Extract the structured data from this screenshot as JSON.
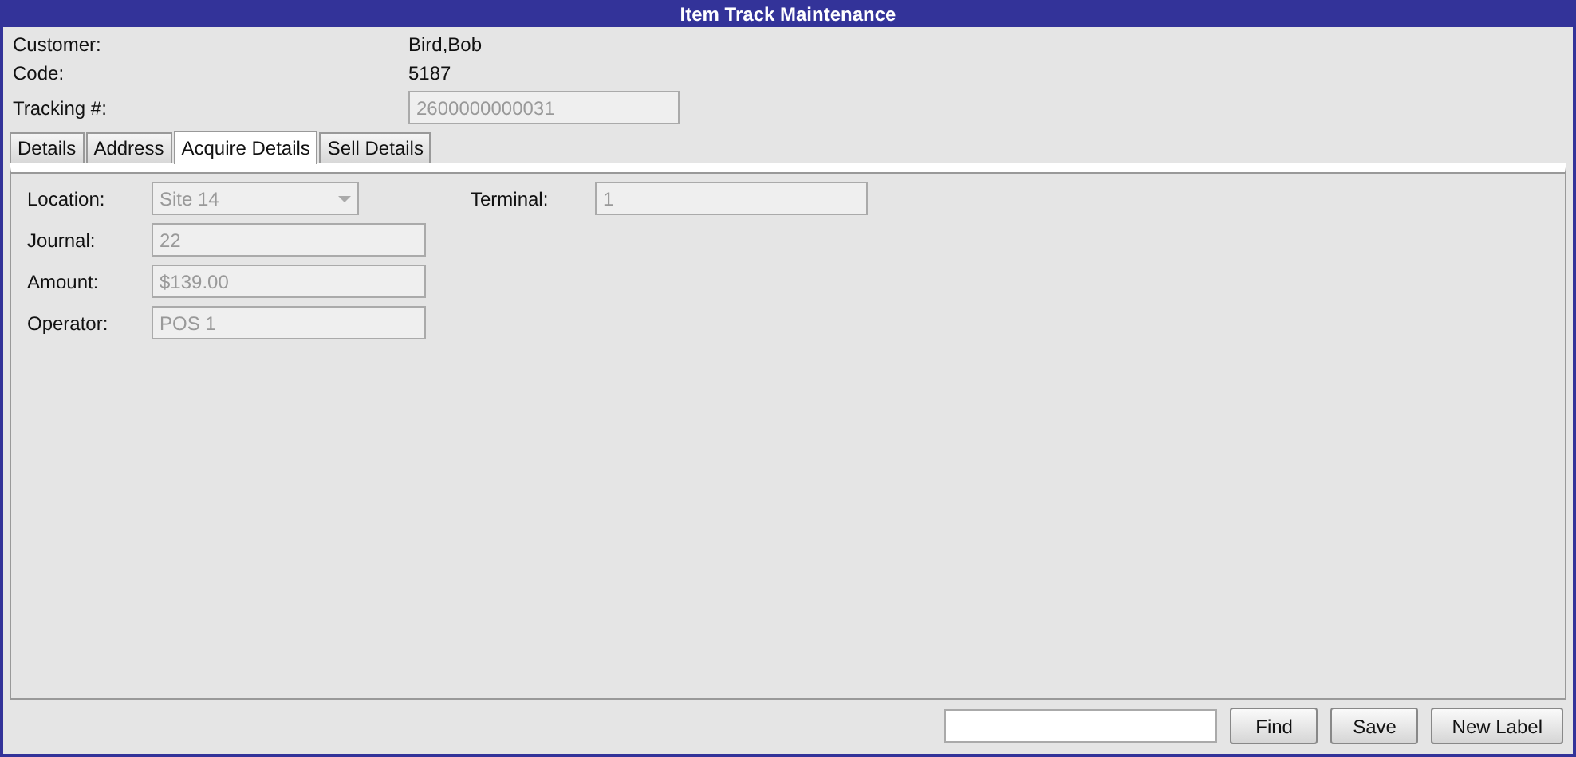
{
  "window": {
    "title": "Item Track Maintenance"
  },
  "header": [
    {
      "label": "Customer:",
      "kind": "text",
      "value": "Bird,Bob"
    },
    {
      "label": "Code:",
      "kind": "text",
      "value": "5187"
    },
    {
      "label": "Tracking #:",
      "kind": "field",
      "value": "2600000000031",
      "disabled": true
    }
  ],
  "tabs": [
    {
      "label": "Details",
      "selected": false
    },
    {
      "label": "Address",
      "selected": false
    },
    {
      "label": "Acquire Details",
      "selected": true
    },
    {
      "label": "Sell Details",
      "selected": false
    }
  ],
  "form_left": [
    {
      "label": "Location:",
      "kind": "dropdown",
      "value": "Site 14",
      "disabled": true
    },
    {
      "label": "Journal:",
      "kind": "field",
      "value": "22",
      "disabled": true
    },
    {
      "label": "Amount:",
      "kind": "field",
      "value": "$139.00",
      "disabled": true
    },
    {
      "label": "Operator:",
      "kind": "field",
      "value": "POS 1",
      "disabled": true
    }
  ],
  "form_right": [
    {
      "label": "Terminal:",
      "kind": "field",
      "value": "1",
      "disabled": true
    }
  ],
  "footer": {
    "buttons": [
      "Find",
      "Save",
      "New Label"
    ]
  }
}
